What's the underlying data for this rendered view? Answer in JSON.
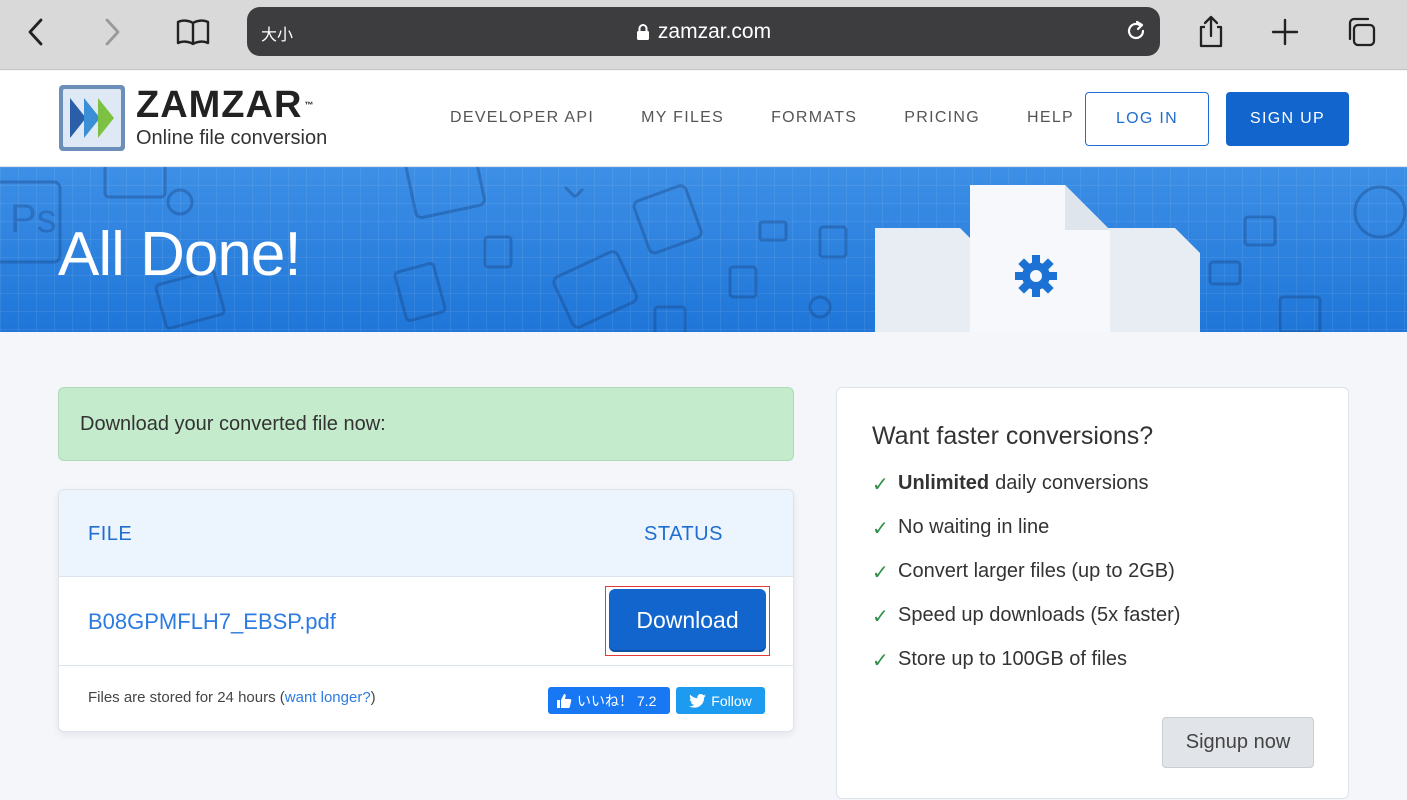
{
  "browser": {
    "text_size_label": "大小",
    "url": "zamzar.com"
  },
  "header": {
    "logo_name": "ZAMZAR",
    "logo_tm": "™",
    "logo_tagline": "Online file conversion",
    "nav": [
      "DEVELOPER API",
      "MY FILES",
      "FORMATS",
      "PRICING",
      "HELP"
    ],
    "login_label": "LOG IN",
    "signup_label": "SIGN UP"
  },
  "banner": {
    "title": "All Done!"
  },
  "alert": {
    "text": "Download your converted file now:"
  },
  "files": {
    "columns": {
      "file": "FILE",
      "status": "STATUS"
    },
    "rows": [
      {
        "name": "B08GPMFLH7_EBSP.pdf",
        "action": "Download"
      }
    ],
    "footer_text": "Files are stored for 24 hours (",
    "footer_link": "want longer?",
    "footer_end": ")",
    "like_label": "いいね！ 7.2",
    "follow_label": "Follow"
  },
  "promo": {
    "title": "Want faster conversions?",
    "items": [
      {
        "bold": "Unlimited",
        "text": "daily conversions"
      },
      {
        "bold": "",
        "text": "No waiting in line"
      },
      {
        "bold": "",
        "text": "Convert larger files (up to 2GB)"
      },
      {
        "bold": "",
        "text": "Speed up downloads (5x faster)"
      },
      {
        "bold": "",
        "text": "Store up to 100GB of files"
      }
    ],
    "check_glyph": "✓",
    "button_label": "Signup now"
  },
  "colors": {
    "brand_blue": "#1265cc",
    "success_green": "#c4ebcb",
    "highlight_red": "#e23b3b"
  }
}
